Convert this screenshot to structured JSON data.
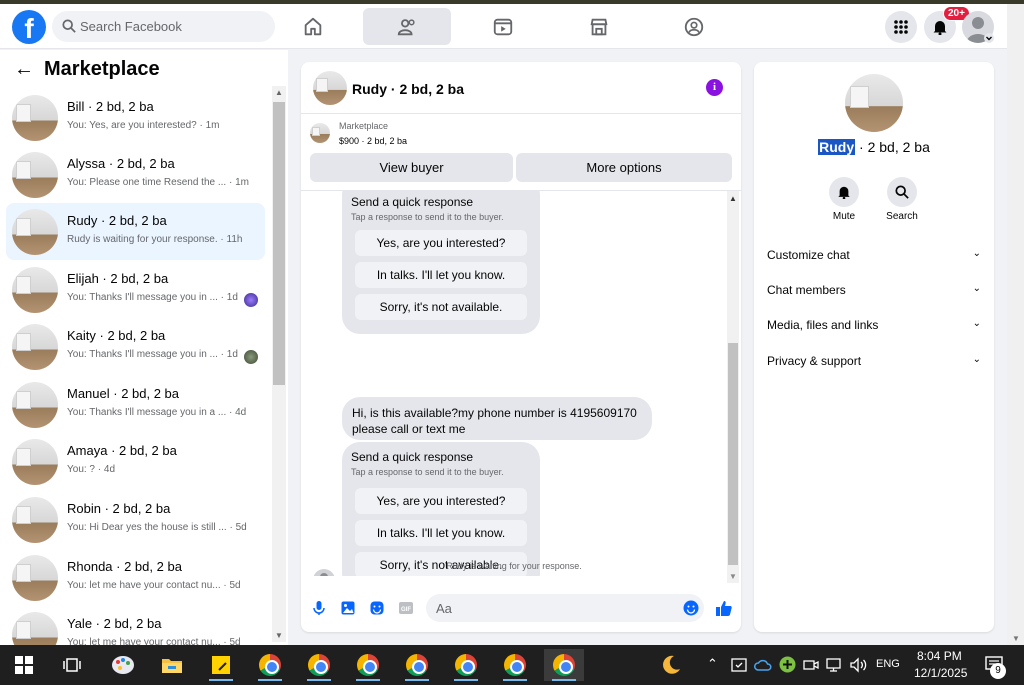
{
  "header": {
    "logo_letter": "f",
    "search_placeholder": "Search Facebook",
    "notification_count": "20+",
    "brand_color": "#1877f2"
  },
  "sidebar": {
    "title": "Marketplace",
    "conversations": [
      {
        "name": "Bill · 2 bd, 2 ba",
        "snippet": "You: Yes, are you interested? · 1m"
      },
      {
        "name": "Alyssa · 2 bd, 2 ba",
        "snippet": "You: Please one time Resend the ... · 1m"
      },
      {
        "name": "Rudy · 2 bd, 2 ba",
        "snippet": "Rudy is waiting for your response. · 11h"
      },
      {
        "name": "Elijah · 2 bd, 2 ba",
        "snippet": "You: Thanks I'll message you in ... · 1d"
      },
      {
        "name": "Kaity · 2 bd, 2 ba",
        "snippet": "You: Thanks I'll message you in ... · 1d"
      },
      {
        "name": "Manuel · 2 bd, 2 ba",
        "snippet": "You: Thanks I'll message you in a ... · 4d"
      },
      {
        "name": "Amaya · 2 bd, 2 ba",
        "snippet": "You: ? · 4d"
      },
      {
        "name": "Robin · 2 bd, 2 ba",
        "snippet": "You: Hi Dear yes the house is still ... · 5d"
      },
      {
        "name": "Rhonda · 2 bd, 2 ba",
        "snippet": "You: let me have your contact nu... · 5d"
      },
      {
        "name": "Yale · 2 bd, 2 ba",
        "snippet": "You: let me have your contact nu... · 5d"
      }
    ]
  },
  "chat": {
    "title": "Rudy · 2 bd, 2 ba",
    "info_icon": "i",
    "marketplace_label": "Marketplace",
    "listing_summary": "$900 · 2 bd, 2 ba",
    "view_buyer": "View buyer",
    "more_options": "More options",
    "quick_title": "Send a quick response",
    "quick_sub": "Tap a response to send it to the buyer.",
    "quick_options": [
      "Yes, are you interested?",
      "In talks. I'll let you know.",
      "Sorry, it's not available."
    ],
    "buyer_message": "Hi, is this available?my phone number is 4195609170 please call or text me",
    "waiting_text": "Rudy is waiting for your response.",
    "composer_placeholder": "Aa"
  },
  "details": {
    "name_highlight": "Rudy",
    "name_rest": " · 2 bd, 2 ba",
    "mute": "Mute",
    "search": "Search",
    "sections": [
      "Customize chat",
      "Chat members",
      "Media, files and links",
      "Privacy & support"
    ]
  },
  "taskbar": {
    "language": "ENG",
    "time": "8:04 PM",
    "date": "12/1/2025",
    "notification_count": "9"
  }
}
